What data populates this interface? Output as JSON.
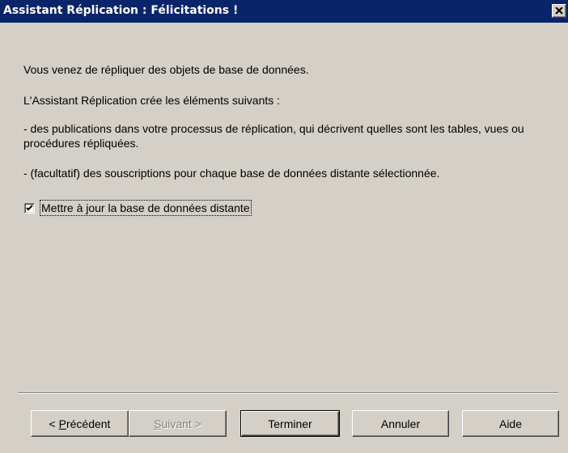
{
  "window": {
    "title": "Assistant Réplication : Félicitations !",
    "colors": {
      "title_bar": "#0a246a",
      "face": "#d4d0c8"
    }
  },
  "titlebar_icons": {
    "close": "close-icon"
  },
  "content": {
    "line1": "Vous venez de répliquer des objets de base de données.",
    "line2": "L'Assistant Réplication crée les éléments suivants :",
    "line3": "- des publications dans votre processus de réplication, qui décrivent quelles sont les tables, vues ou procédures répliquées.",
    "line4": "- (facultatif) des souscriptions pour chaque base de données distante sélectionnée."
  },
  "option": {
    "label": "Mettre à jour la base de données distante",
    "checked": true
  },
  "buttons": {
    "prev": {
      "prefix": "< ",
      "mnemonic": "P",
      "rest": "récédent"
    },
    "next": {
      "mnemonic": "S",
      "rest": "uivant >",
      "disabled": true
    },
    "finish": "Terminer",
    "cancel": "Annuler",
    "help": "Aide"
  }
}
